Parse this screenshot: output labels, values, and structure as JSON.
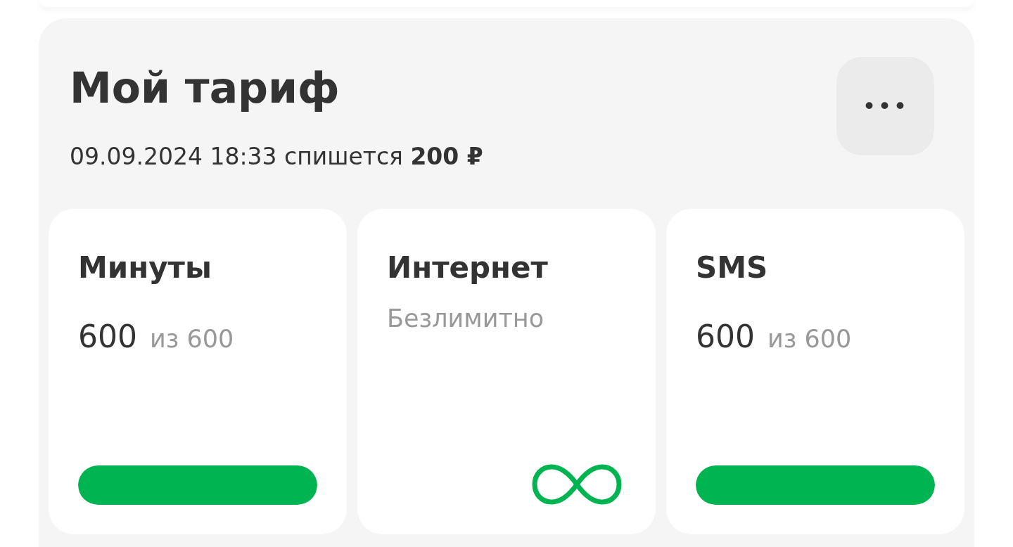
{
  "tariff": {
    "title": "Мой тариф",
    "charge": "09.09.2024 18:33 спишется **200 ₽**",
    "menu_button": {
      "label": "•••"
    },
    "packages": [
      {
        "kind": "meter",
        "name": "Минуты",
        "value": "600",
        "total": "из 600",
        "level": 1
      },
      {
        "kind": "unlimited",
        "name": "Интернет",
        "text": "Безлимитно"
      },
      {
        "kind": "meter",
        "name": "SMS",
        "value": "600",
        "total": "из 600",
        "level": 1
      }
    ]
  }
}
